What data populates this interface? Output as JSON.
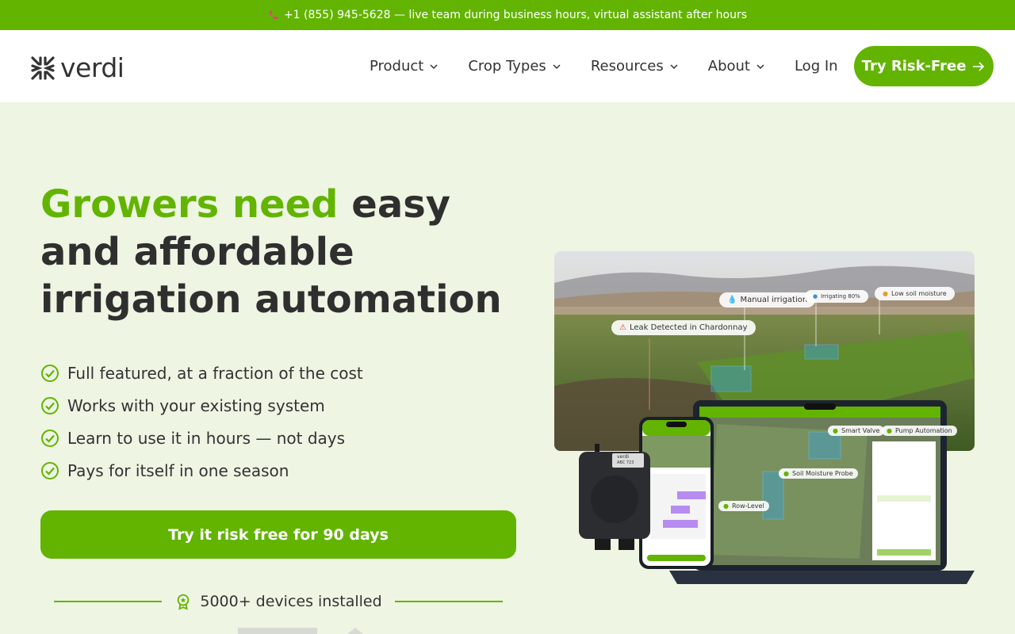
{
  "topbar": {
    "text": "+1 (855) 945-5628 — live team during business hours, virtual assistant after hours"
  },
  "header": {
    "logo_text": "verdi",
    "nav": [
      {
        "label": "Product"
      },
      {
        "label": "Crop Types"
      },
      {
        "label": "Resources"
      },
      {
        "label": "About"
      }
    ],
    "login": "Log In",
    "cta": "Try Risk-Free"
  },
  "hero": {
    "title_green": "Growers need",
    "title_rest": " easy and affordable irrigation automation",
    "features": [
      "Full featured, at a fraction of the cost",
      "Works with your existing system",
      "Learn to use it in hours — not days",
      "Pays for itself in one season"
    ],
    "primary_button": "Try it risk free for 90 days",
    "devices_count": "5000+ devices installed"
  },
  "image_tags": {
    "manual": "Manual irrigation",
    "irrigating": "Irrigating 80%",
    "low_moisture": "Low soil moisture",
    "leak": "Leak Detected in Chardonnay",
    "smart_valve": "Smart Valve",
    "pump": "Pump Automation",
    "soil_probe": "Soil Moisture Probe",
    "row_level": "Row-Level"
  },
  "device": {
    "sensor_label": "verdi",
    "sensor_code": "ABC 723"
  },
  "colors": {
    "brand_green": "#62b400",
    "hero_bg": "#eef5e3"
  }
}
